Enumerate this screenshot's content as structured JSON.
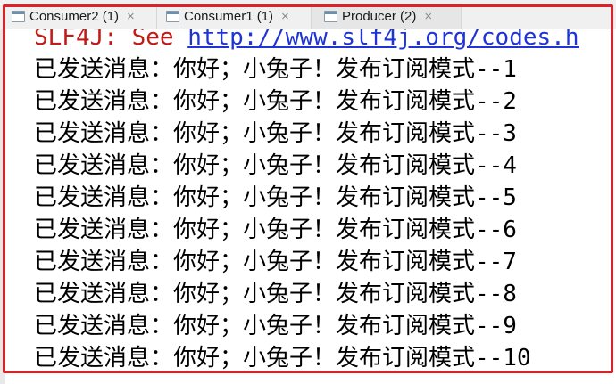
{
  "tabs": [
    {
      "label": "Consumer2 (1)",
      "close": "×"
    },
    {
      "label": "Consumer1 (1)",
      "close": "×"
    },
    {
      "label": "Producer (2)",
      "close": "×"
    }
  ],
  "console": {
    "warning_prefix": "SLF4J: See ",
    "warning_link": "http://www.slf4j.org/codes.h",
    "lines": [
      "已发送消息：你好；小兔子！发布订阅模式--1",
      "已发送消息：你好；小兔子！发布订阅模式--2",
      "已发送消息：你好；小兔子！发布订阅模式--3",
      "已发送消息：你好；小兔子！发布订阅模式--4",
      "已发送消息：你好；小兔子！发布订阅模式--5",
      "已发送消息：你好；小兔子！发布订阅模式--6",
      "已发送消息：你好；小兔子！发布订阅模式--7",
      "已发送消息：你好；小兔子！发布订阅模式--8",
      "已发送消息：你好；小兔子！发布订阅模式--9",
      "已发送消息：你好；小兔子！发布订阅模式--10"
    ]
  },
  "colors": {
    "highlight": "#e02027",
    "warning_text": "#c41a16",
    "link": "#1f34d6"
  }
}
